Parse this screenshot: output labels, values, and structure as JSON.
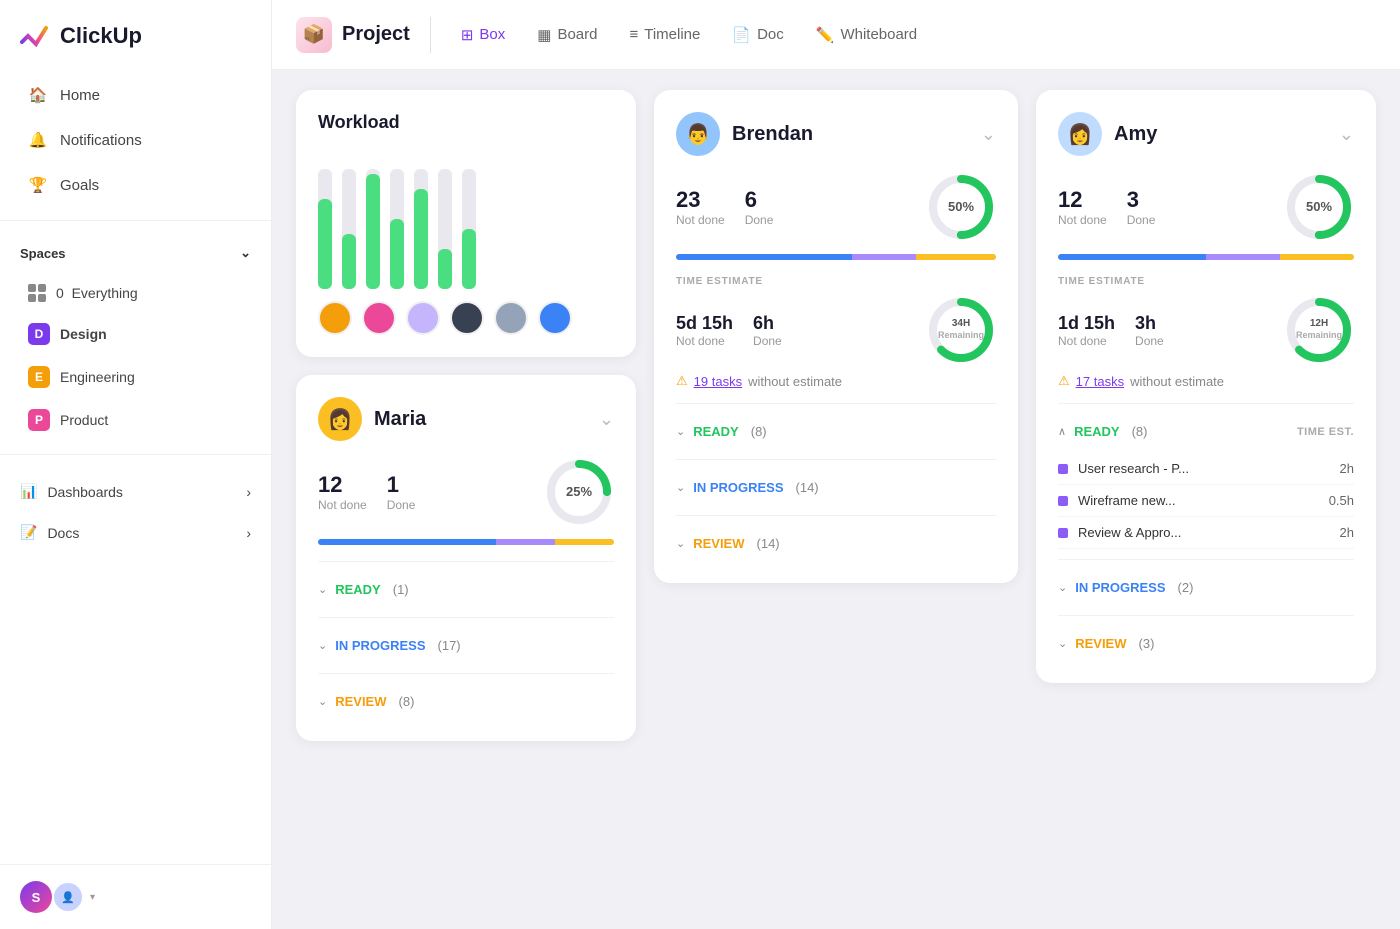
{
  "app": {
    "name": "ClickUp"
  },
  "sidebar": {
    "nav": [
      {
        "id": "home",
        "label": "Home",
        "icon": "🏠"
      },
      {
        "id": "notifications",
        "label": "Notifications",
        "icon": "🔔"
      },
      {
        "id": "goals",
        "label": "Goals",
        "icon": "🏆"
      }
    ],
    "spaces_title": "Spaces",
    "spaces": [
      {
        "id": "everything",
        "label": "Everything",
        "count": "0"
      },
      {
        "id": "design",
        "label": "Design",
        "color": "design",
        "letter": "D"
      },
      {
        "id": "engineering",
        "label": "Engineering",
        "color": "engineering",
        "letter": "E"
      },
      {
        "id": "product",
        "label": "Product",
        "color": "product",
        "letter": "P"
      }
    ],
    "bottom": [
      {
        "id": "dashboards",
        "label": "Dashboards",
        "arrow": true
      },
      {
        "id": "docs",
        "label": "Docs",
        "arrow": true
      }
    ],
    "user_initial": "S"
  },
  "topbar": {
    "project_label": "Project",
    "tabs": [
      {
        "id": "box",
        "label": "Box",
        "icon": "⊞",
        "active": true
      },
      {
        "id": "board",
        "label": "Board",
        "icon": "▦"
      },
      {
        "id": "timeline",
        "label": "Timeline",
        "icon": "≡"
      },
      {
        "id": "doc",
        "label": "Doc",
        "icon": "📄"
      },
      {
        "id": "whiteboard",
        "label": "Whiteboard",
        "icon": "✏️"
      }
    ]
  },
  "workload": {
    "title": "Workload",
    "bars": [
      {
        "bg_height": 120,
        "fill_height": 90
      },
      {
        "bg_height": 120,
        "fill_height": 55
      },
      {
        "bg_height": 120,
        "fill_height": 115
      },
      {
        "bg_height": 120,
        "fill_height": 70
      },
      {
        "bg_height": 120,
        "fill_height": 100
      },
      {
        "bg_height": 120,
        "fill_height": 40
      },
      {
        "bg_height": 120,
        "fill_height": 60
      }
    ],
    "avatar_colors": [
      "#f59e0b",
      "#ec4899",
      "#8b5cf6",
      "#1a1a2e",
      "#94a3b8",
      "#3b82f6"
    ]
  },
  "brendan": {
    "name": "Brendan",
    "not_done": 23,
    "done": 6,
    "not_done_label": "Not done",
    "done_label": "Done",
    "percent": 50,
    "percent_label": "50%",
    "remaining_label": "Remaining",
    "time_estimate_section": "TIME ESTIMATE",
    "time_not_done": "5d 15h",
    "time_done": "6h",
    "total_remaining": "34H",
    "time_not_done_label": "Not done",
    "time_done_label": "Done",
    "tasks_warning": "19 tasks",
    "tasks_warning_suffix": "without estimate",
    "progress_blue": 55,
    "progress_purple": 20,
    "progress_yellow": 25,
    "statuses": [
      {
        "id": "ready",
        "label": "READY",
        "count": "(8)",
        "color": "ready"
      },
      {
        "id": "inprogress",
        "label": "IN PROGRESS",
        "count": "(14)",
        "color": "inprogress"
      },
      {
        "id": "review",
        "label": "REVIEW",
        "count": "(14)",
        "color": "review"
      }
    ]
  },
  "amy": {
    "name": "Amy",
    "not_done": 12,
    "done": 3,
    "not_done_label": "Not done",
    "done_label": "Done",
    "percent": 50,
    "percent_label": "50%",
    "remaining_label": "Remaining",
    "time_estimate_section": "TIME ESTIMATE",
    "time_not_done": "1d 15h",
    "time_done": "3h",
    "total_remaining": "12H",
    "time_not_done_label": "Not done",
    "time_done_label": "Done",
    "tasks_warning": "17 tasks",
    "tasks_warning_suffix": "without estimate",
    "progress_blue": 50,
    "progress_purple": 25,
    "progress_yellow": 25,
    "statuses": [
      {
        "id": "ready",
        "label": "READY",
        "count": "(8)",
        "color": "ready",
        "time_est": "TIME EST."
      },
      {
        "id": "inprogress",
        "label": "IN PROGRESS",
        "count": "(2)",
        "color": "inprogress"
      },
      {
        "id": "review",
        "label": "REVIEW",
        "count": "(3)",
        "color": "review"
      }
    ],
    "tasks": [
      {
        "name": "User research - P...",
        "time": "2h"
      },
      {
        "name": "Wireframe new...",
        "time": "0.5h"
      },
      {
        "name": "Review & Appro...",
        "time": "2h"
      }
    ]
  },
  "maria": {
    "name": "Maria",
    "not_done": 12,
    "done": 1,
    "not_done_label": "Not done",
    "done_label": "Done",
    "percent": 25,
    "percent_label": "25%",
    "progress_blue": 60,
    "progress_purple": 20,
    "progress_yellow": 20,
    "statuses": [
      {
        "id": "ready",
        "label": "READY",
        "count": "(1)",
        "color": "ready"
      },
      {
        "id": "inprogress",
        "label": "IN PROGRESS",
        "count": "(17)",
        "color": "inprogress"
      },
      {
        "id": "review",
        "label": "REVIEW",
        "count": "(8)",
        "color": "review"
      }
    ]
  }
}
